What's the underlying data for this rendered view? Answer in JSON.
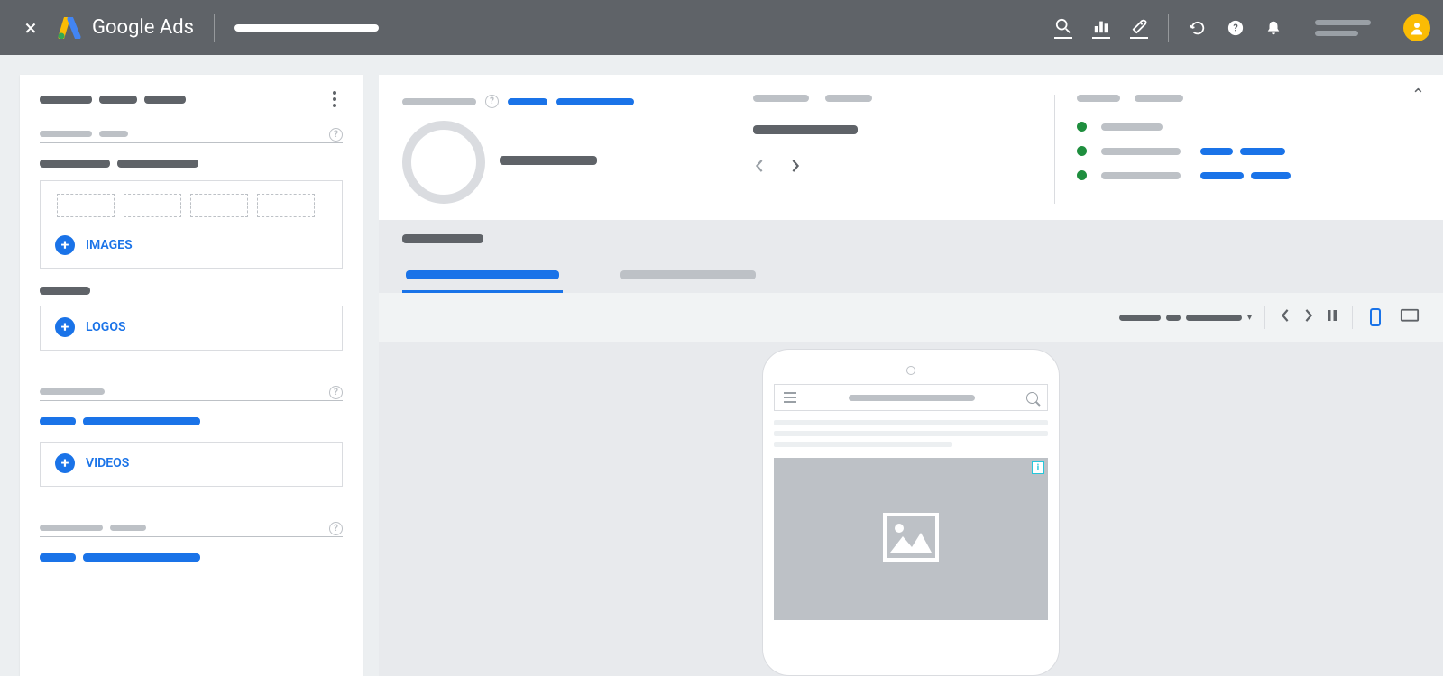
{
  "app": {
    "name": "Google Ads"
  },
  "topbar": {
    "close": "×",
    "search_aria": "Search",
    "reports_aria": "Reports",
    "tools_aria": "Tools",
    "refresh_aria": "Refresh",
    "help_aria": "Help",
    "notifications_aria": "Notifications"
  },
  "sidebar": {
    "assets": {
      "images_label": "IMAGES",
      "logos_label": "LOGOS",
      "videos_label": "VIDEOS"
    }
  },
  "summary": {
    "collapse": "⌃",
    "prev": "‹",
    "next": "›"
  },
  "preview": {
    "prev": "‹",
    "next": "›",
    "pause": "⏸",
    "dropdown_caret": "▾",
    "tabs": {
      "active": "tab1"
    },
    "device": "mobile",
    "ad_info": "i"
  },
  "colors": {
    "primary": "#1a73e8",
    "green": "#1e8e3e",
    "grey": "#5f6368"
  }
}
